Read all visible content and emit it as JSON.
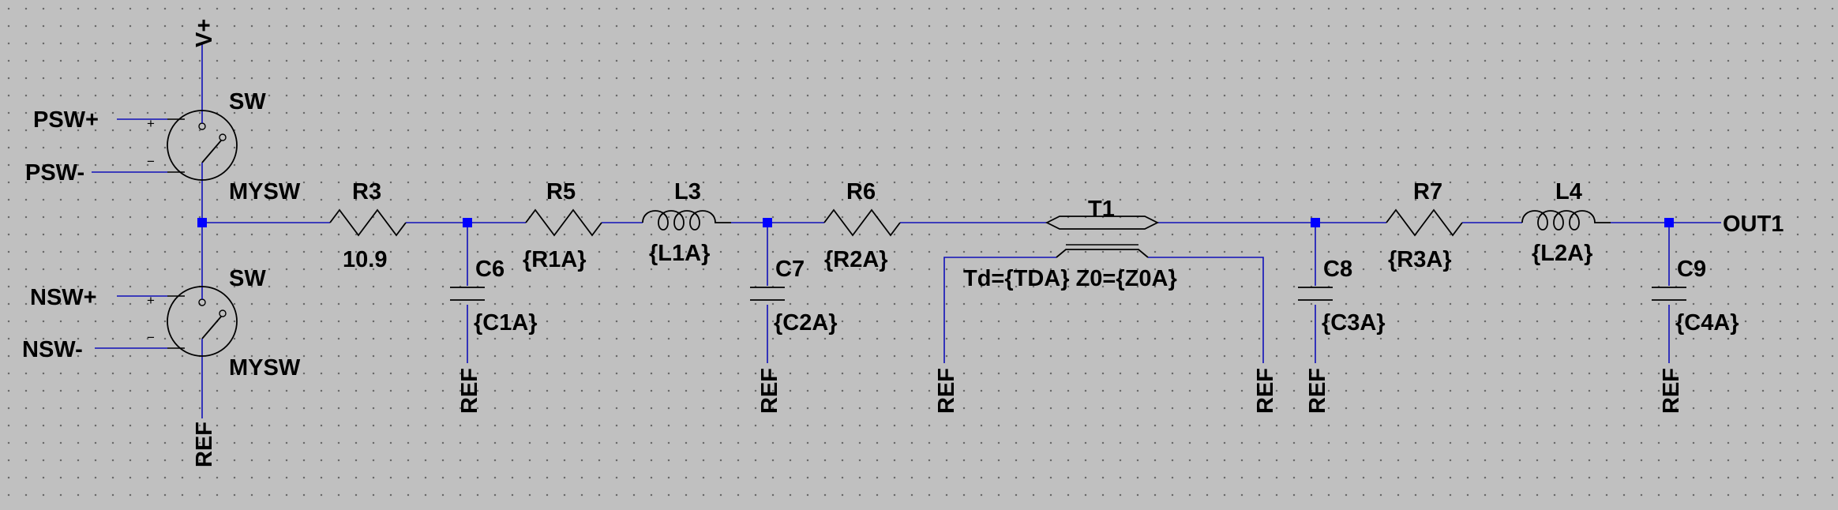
{
  "nets": {
    "vplus": "V+",
    "psw_plus": "PSW+",
    "psw_minus": "PSW-",
    "nsw_plus": "NSW+",
    "nsw_minus": "NSW-",
    "out1": "OUT1",
    "ref": "REF"
  },
  "switches": [
    {
      "name": "SW",
      "model": "MYSW",
      "pin_plus": "+",
      "pin_minus": "−"
    },
    {
      "name": "SW",
      "model": "MYSW",
      "pin_plus": "+",
      "pin_minus": "−"
    }
  ],
  "resistors": [
    {
      "name": "R3",
      "value": "10.9"
    },
    {
      "name": "R5",
      "value": "{R1A}"
    },
    {
      "name": "R6",
      "value": "{R2A}"
    },
    {
      "name": "R7",
      "value": "{R3A}"
    }
  ],
  "inductors": [
    {
      "name": "L3",
      "value": "{L1A}"
    },
    {
      "name": "L4",
      "value": "{L2A}"
    }
  ],
  "capacitors": [
    {
      "name": "C6",
      "value": "{C1A}"
    },
    {
      "name": "C7",
      "value": "{C2A}"
    },
    {
      "name": "C8",
      "value": "{C3A}"
    },
    {
      "name": "C9",
      "value": "{C4A}"
    }
  ],
  "tline": {
    "name": "T1",
    "value": "Td={TDA} Z0={Z0A}"
  },
  "colors": {
    "wire": "#1010b8",
    "junction": "#0000ff",
    "background": "#c0c0c0",
    "component": "#000000"
  }
}
